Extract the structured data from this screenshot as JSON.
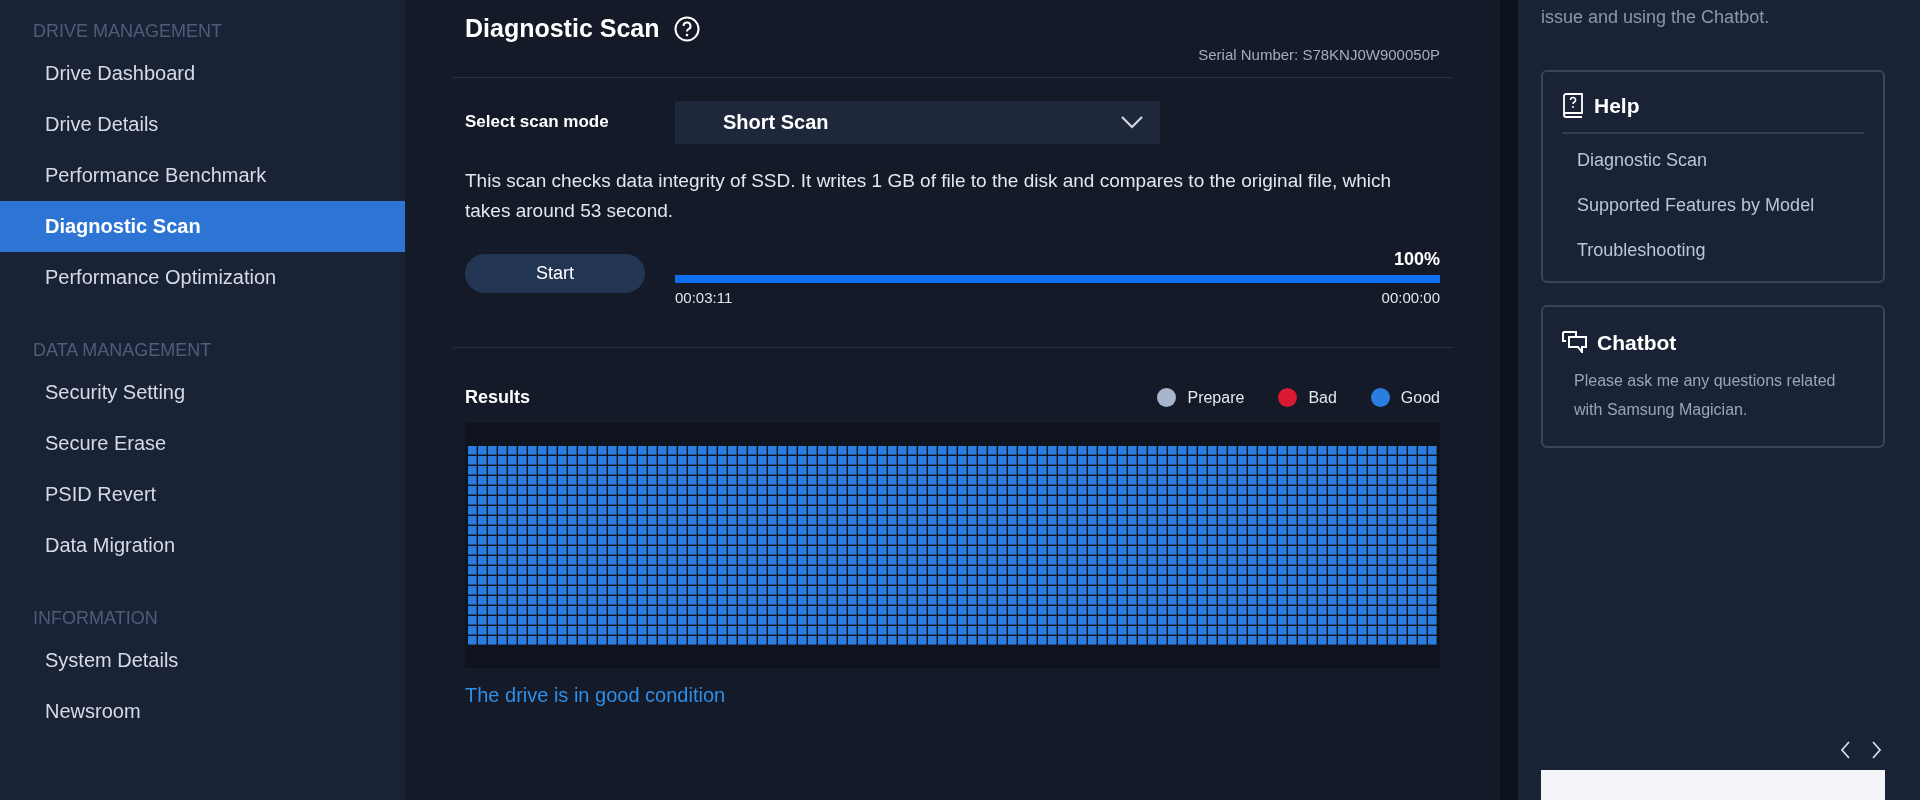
{
  "sidebar": {
    "sections": [
      {
        "heading": "DRIVE MANAGEMENT",
        "items": [
          {
            "label": "Drive Dashboard",
            "selected": false
          },
          {
            "label": "Drive Details",
            "selected": false
          },
          {
            "label": "Performance Benchmark",
            "selected": false
          },
          {
            "label": "Diagnostic Scan",
            "selected": true
          },
          {
            "label": "Performance Optimization",
            "selected": false
          }
        ]
      },
      {
        "heading": "DATA MANAGEMENT",
        "items": [
          {
            "label": "Security Setting",
            "selected": false
          },
          {
            "label": "Secure Erase",
            "selected": false
          },
          {
            "label": "PSID Revert",
            "selected": false
          },
          {
            "label": "Data Migration",
            "selected": false
          }
        ]
      },
      {
        "heading": "INFORMATION",
        "items": [
          {
            "label": "System Details",
            "selected": false
          },
          {
            "label": "Newsroom",
            "selected": false
          }
        ]
      }
    ]
  },
  "main": {
    "title": "Diagnostic Scan",
    "serial": "Serial Number: S78KNJ0W900050P",
    "scan_mode_label": "Select scan mode",
    "scan_mode": "Short Scan",
    "description": "This scan checks data integrity of SSD. It writes 1 GB of file to the disk and compares to the original file, which takes around 53 second.",
    "start_button": "Start",
    "progress": {
      "percent": "100%",
      "level": 1,
      "elapsed": "00:03:11",
      "remaining": "00:00:00"
    },
    "results": {
      "title": "Results",
      "legend": [
        {
          "kind": "prepare",
          "label": "Prepare",
          "color": "#a9b5cc"
        },
        {
          "kind": "bad",
          "label": "Bad",
          "color": "#d91a32"
        },
        {
          "kind": "good",
          "label": "Good",
          "color": "#2b7de0"
        }
      ],
      "block_map": {
        "kind": "good"
      },
      "message": "The drive is in good condition"
    }
  },
  "right_panel": {
    "intro": "issue and using the Chatbot.",
    "help": {
      "title": "Help",
      "links": [
        "Diagnostic Scan",
        "Supported Features by Model",
        "Troubleshooting"
      ]
    },
    "chatbot": {
      "title": "Chatbot",
      "text": "Please ask me any questions related with Samsung Magician."
    }
  }
}
